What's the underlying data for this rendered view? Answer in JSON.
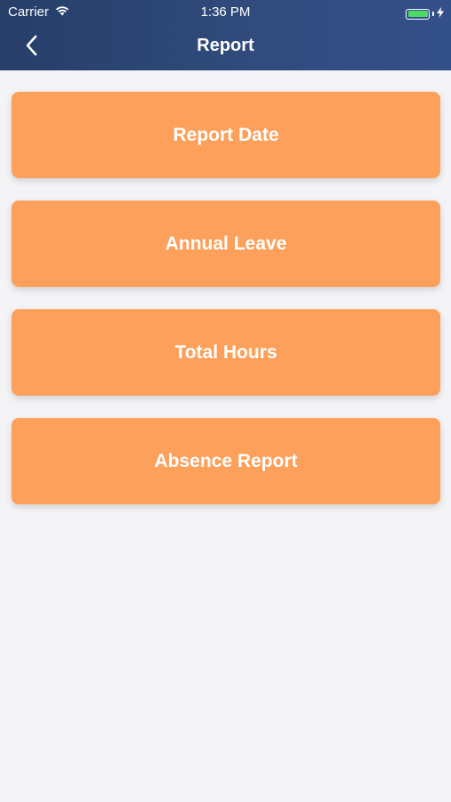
{
  "status_bar": {
    "carrier": "Carrier",
    "time": "1:36 PM",
    "battery_color": "#4cd964"
  },
  "nav": {
    "back_icon": "chevron-left-icon",
    "title": "Report"
  },
  "menu": {
    "items": [
      {
        "label": "Report Date"
      },
      {
        "label": "Annual Leave"
      },
      {
        "label": "Total Hours"
      },
      {
        "label": "Absence Report"
      }
    ],
    "button_color": "#fca05b"
  },
  "colors": {
    "header_gradient_start": "#263e68",
    "header_gradient_end": "#34508a",
    "background": "#f4f4f7"
  }
}
